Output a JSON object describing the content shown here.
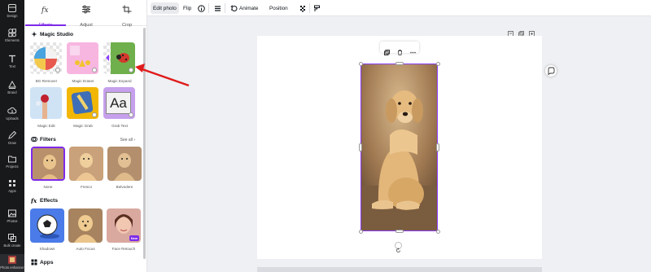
{
  "rail": {
    "items": [
      {
        "label": "Design"
      },
      {
        "label": "Elements"
      },
      {
        "label": "Text"
      },
      {
        "label": "Brand"
      },
      {
        "label": "Uploads"
      },
      {
        "label": "Draw"
      },
      {
        "label": "Projects"
      },
      {
        "label": "Apps"
      },
      {
        "label": "Photos"
      },
      {
        "label": "Bulk create"
      },
      {
        "label": "Photo enhancer"
      }
    ]
  },
  "panel": {
    "tabs": [
      {
        "label": "Effects",
        "icon": "fx-icon"
      },
      {
        "label": "Adjust",
        "icon": "sliders-icon"
      },
      {
        "label": "Crop",
        "icon": "crop-icon"
      }
    ],
    "magic_studio": {
      "title": "Magic Studio",
      "tiles": [
        {
          "label": "BG Remover"
        },
        {
          "label": "Magic Eraser"
        },
        {
          "label": "Magic Expand"
        },
        {
          "label": "Magic Edit"
        },
        {
          "label": "Magic Grab"
        },
        {
          "label": "Grab Text"
        }
      ],
      "grab_text_sample": "Aa"
    },
    "filters": {
      "title": "Filters",
      "see_all": "See all",
      "tiles": [
        {
          "label": "None"
        },
        {
          "label": "Fresco"
        },
        {
          "label": "Belvedere"
        }
      ]
    },
    "effects": {
      "title": "Effects",
      "tiles": [
        {
          "label": "Shadows"
        },
        {
          "label": "Auto Focus"
        },
        {
          "label": "Face Retouch",
          "badge": "New"
        }
      ]
    },
    "apps": {
      "title": "Apps"
    }
  },
  "toolbar": {
    "edit_photo": "Edit photo",
    "flip": "Flip",
    "animate": "Animate",
    "position": "Position"
  },
  "colors": {
    "accent": "#7d2ae8",
    "selection": "#8b3dff",
    "annotation_arrow": "#e01b1b"
  }
}
